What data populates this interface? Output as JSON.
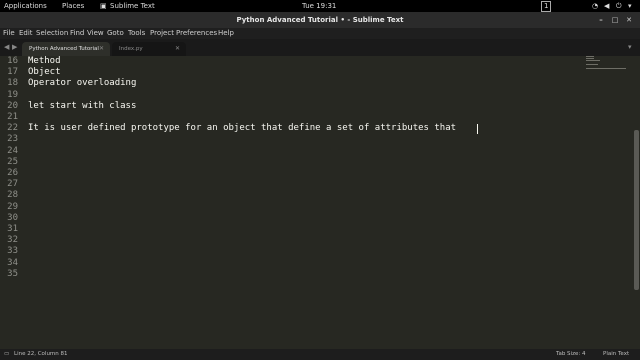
{
  "topbar": {
    "applications": "Applications",
    "places": "Places",
    "app": "Sublime Text",
    "clock": "Tue 19:31",
    "workspace": "1"
  },
  "window": {
    "title": "Python Advanced Tutorial • - Sublime Text"
  },
  "menu": [
    "File",
    "Edit",
    "Selection",
    "Find",
    "View",
    "Goto",
    "Tools",
    "Project",
    "Preferences",
    "Help"
  ],
  "tabs": [
    {
      "label": "Python Advanced Tutorial",
      "active": true
    },
    {
      "label": "Index.py",
      "active": false
    }
  ],
  "editor": {
    "line_numbers": [
      "16",
      "17",
      "18",
      "19",
      "20",
      "21",
      "22",
      "23",
      "24",
      "25",
      "26",
      "27",
      "28",
      "29",
      "30",
      "31",
      "32",
      "33",
      "34",
      "35"
    ],
    "lines": [
      "Method",
      "Object",
      "Operator overloading",
      "",
      "let start with class",
      "",
      "It is user defined prototype for an object that define a set of attributes that ",
      "",
      "",
      "",
      "",
      "",
      "",
      "",
      "",
      "",
      "",
      "",
      "",
      ""
    ]
  },
  "status": {
    "position": "Line 22, Column 81",
    "tab_size": "Tab Size: 4",
    "syntax": "Plain Text"
  },
  "colors": {
    "editor_bg": "#272822",
    "text": "#f8f8f2",
    "line_numbers": "#8f908a"
  }
}
